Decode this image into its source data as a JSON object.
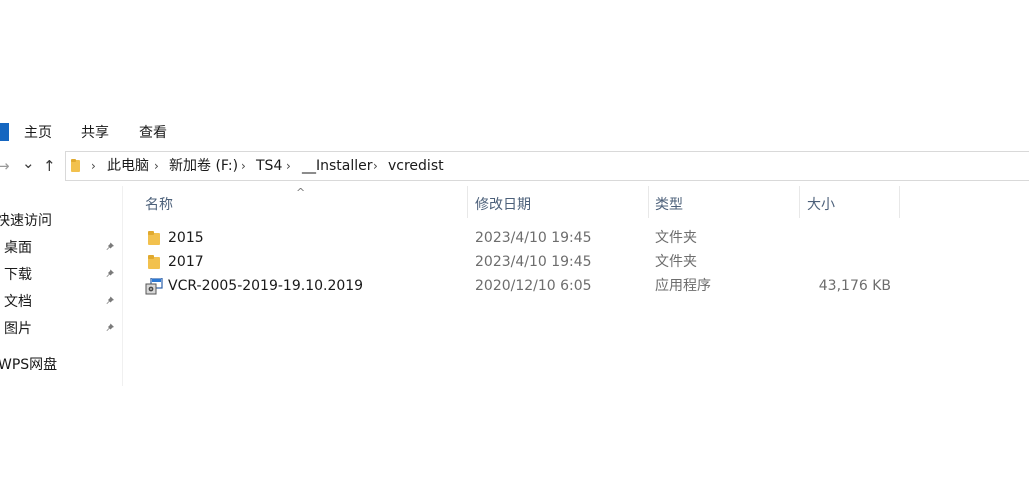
{
  "ribbon": {
    "tabs": [
      {
        "label": "主页"
      },
      {
        "label": "共享"
      },
      {
        "label": "查看"
      }
    ]
  },
  "nav": {
    "forward_glyph": "→",
    "history_glyph": "⌄",
    "up_glyph": "↑"
  },
  "address": {
    "separator": "›",
    "crumbs": [
      "此电脑",
      "新加卷 (F:)",
      "TS4",
      "__Installer",
      "vcredist"
    ]
  },
  "sidebar": {
    "items": [
      {
        "label": "快速访问"
      },
      {
        "label": "桌面",
        "pinned": true
      },
      {
        "label": "下载",
        "pinned": true
      },
      {
        "label": "文档",
        "pinned": true
      },
      {
        "label": "图片",
        "pinned": true
      },
      {
        "label": "WPS网盘"
      }
    ]
  },
  "columns": {
    "name": "名称",
    "modified": "修改日期",
    "type": "类型",
    "size": "大小",
    "sort_glyph": "^"
  },
  "files": [
    {
      "name": "2015",
      "modified": "2023/4/10 19:45",
      "type": "文件夹",
      "size": "",
      "icon": "folder-icon"
    },
    {
      "name": "2017",
      "modified": "2023/4/10 19:45",
      "type": "文件夹",
      "size": "",
      "icon": "folder-icon"
    },
    {
      "name": "VCR-2005-2019-19.10.2019",
      "modified": "2020/12/10 6:05",
      "type": "应用程序",
      "size": "43,176 KB",
      "icon": "installer-app-icon"
    }
  ],
  "colors": {
    "accent": "#1566c0",
    "folder": "#f2c14e",
    "header_text": "#4c607a"
  }
}
